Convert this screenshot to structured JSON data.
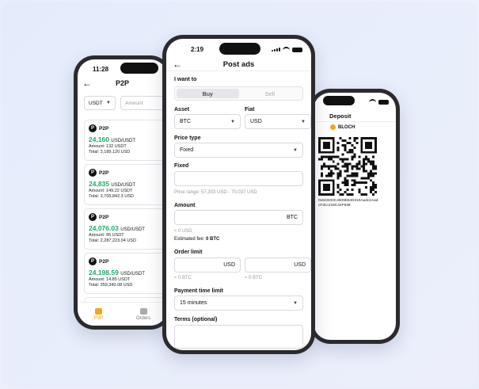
{
  "left": {
    "time": "11:28",
    "title": "P2P",
    "currency_select": "USDT",
    "amount_placeholder": "Amount",
    "offers": [
      {
        "name": "P2P",
        "price": "24,160",
        "unit": "USD/USDT",
        "amount": "Amount: 132 USDT",
        "total": "Total: 3,189,120 USD"
      },
      {
        "name": "P2P",
        "price": "24,835",
        "unit": "USD/USDT",
        "amount": "Amount: 149.22 USDT",
        "total": "Total: 3,705,842.3 USD"
      },
      {
        "name": "P2P",
        "price": "24,076.03",
        "unit": "USD/USDT",
        "amount": "Amount: 95 USDT",
        "total": "Total: 2,287,223.04  USD"
      },
      {
        "name": "P2P",
        "price": "24,198.59",
        "unit": "USD/USDT",
        "amount": "Amount: 14.85 USDT",
        "total": "Total: 359,340.08 USD"
      }
    ],
    "tabs": [
      {
        "label": "P2P"
      },
      {
        "label": "Orders"
      }
    ]
  },
  "center": {
    "time": "2:19",
    "title": "Post ads",
    "want_label": "I want to",
    "buy": "Buy",
    "sell": "Sell",
    "asset_label": "Asset",
    "asset_value": "BTC",
    "fiat_label": "Fiat",
    "fiat_value": "USD",
    "price_type_label": "Price type",
    "price_type_value": "Fixed",
    "fixed_label": "Fixed",
    "price_range": "Price range: 57,303 USD - 70,037 USD",
    "amount_label": "Amount",
    "amount_unit": "BTC",
    "amount_approx": "≈ 0 USD",
    "fee": "Estimated fee: ",
    "fee_value": "0 BTC",
    "order_limit_label": "Order limit",
    "limit_unit_1": "USD",
    "limit_unit_2": "USD",
    "limit_approx_1": "≈ 0 BTC",
    "limit_approx_2": "≈ 0 BTC",
    "payment_label": "Payment time limit",
    "payment_value": "15 minutes",
    "terms_label": "Terms (optional)"
  },
  "right": {
    "title": "Deposit",
    "coin": "BLOCH",
    "address": "0x5CE00C4609b94D310Aadc2AadcFdcc418C44F838"
  }
}
